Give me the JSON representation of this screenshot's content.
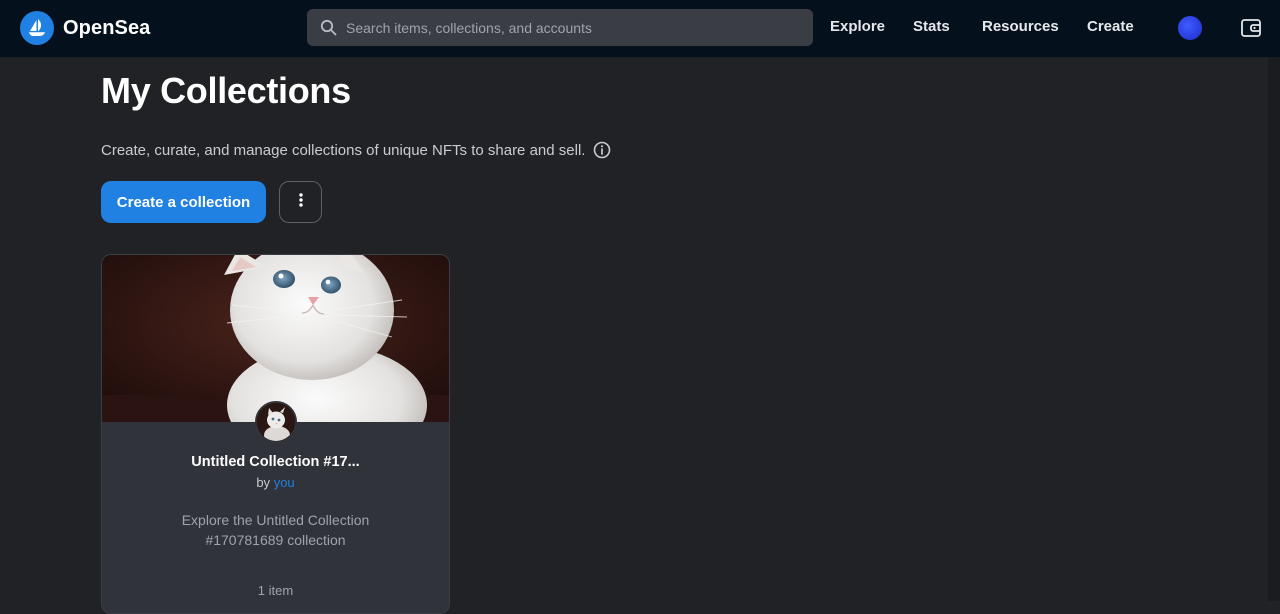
{
  "nav": {
    "brand_name": "OpenSea",
    "search_placeholder": "Search items, collections, and accounts",
    "links": {
      "explore": "Explore",
      "stats": "Stats",
      "resources": "Resources",
      "create": "Create"
    },
    "icons": [
      "opensea-logo-icon",
      "search-icon",
      "profile-avatar-icon",
      "wallet-icon"
    ]
  },
  "main": {
    "title": "My Collections",
    "description": "Create, curate, and manage collections of unique NFTs to share and sell.",
    "create_button": "Create a collection",
    "more_icon": "vertical-ellipsis-icon",
    "info_icon": "info-icon"
  },
  "collections": [
    {
      "title": "Untitled Collection #17...",
      "by_prefix": "by",
      "by_link": "you",
      "description": "Explore the Untitled Collection #170781689 collection",
      "item_count": "1 item",
      "image": "white-kitten-photo"
    }
  ],
  "colors": {
    "accent": "#2081e2",
    "nav_bg": "#04111d",
    "page_bg": "#202225",
    "card_bg": "#303339"
  }
}
